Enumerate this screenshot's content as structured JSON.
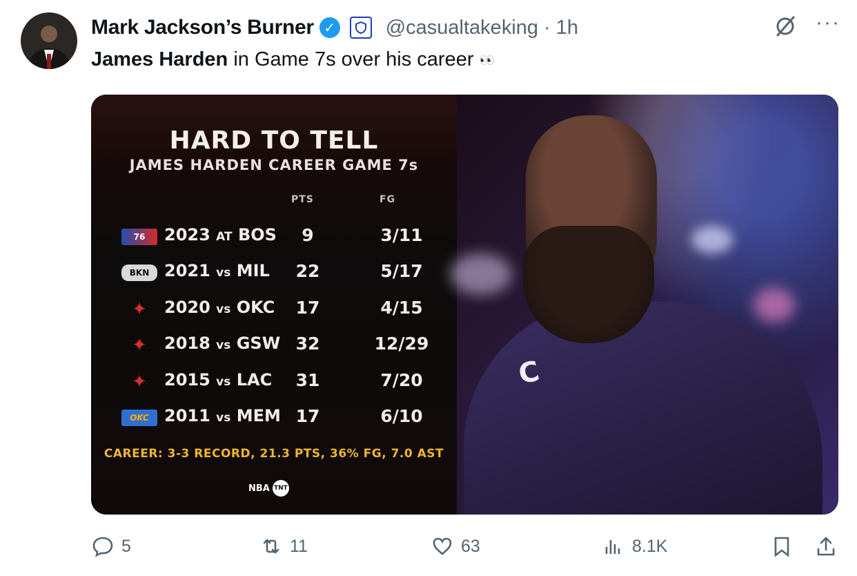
{
  "tweet": {
    "display_name": "Mark Jackson’s Burner",
    "handle": "@casualtakeking",
    "separator": "·",
    "time": "1h",
    "text_bold": "James Harden",
    "text_rest": " in Game 7s over his career",
    "eyes_emoji": "👀"
  },
  "media": {
    "title": "HARD TO TELL",
    "subtitle": "JAMES HARDEN CAREER GAME 7s",
    "col_pts": "PTS",
    "col_fg": "FG",
    "rows": [
      {
        "logo": "76ers",
        "year": "2023",
        "venue": "AT",
        "opp": "BOS",
        "pts": "9",
        "fg": "3/11"
      },
      {
        "logo": "Nets",
        "year": "2021",
        "venue": "vs",
        "opp": "MIL",
        "pts": "22",
        "fg": "5/17"
      },
      {
        "logo": "Rockets",
        "year": "2020",
        "venue": "vs",
        "opp": "OKC",
        "pts": "17",
        "fg": "4/15"
      },
      {
        "logo": "Rockets",
        "year": "2018",
        "venue": "vs",
        "opp": "GSW",
        "pts": "32",
        "fg": "12/29"
      },
      {
        "logo": "Rockets",
        "year": "2015",
        "venue": "vs",
        "opp": "LAC",
        "pts": "31",
        "fg": "7/20"
      },
      {
        "logo": "Thunder",
        "year": "2011",
        "venue": "vs",
        "opp": "MEM",
        "pts": "17",
        "fg": "6/10"
      }
    ],
    "career": "CAREER: 3-3 RECORD,  21.3 PTS,  36% FG,  7.0 AST",
    "brand_nba": "NBA",
    "brand_tnt": "TNT",
    "jersey_letter": "C"
  },
  "actions": {
    "replies": "5",
    "reposts": "11",
    "likes": "63",
    "views": "8.1K"
  },
  "colors": {
    "verified_blue": "#1d9bf0",
    "career_gold": "#f0b62e",
    "muted": "#536471"
  }
}
